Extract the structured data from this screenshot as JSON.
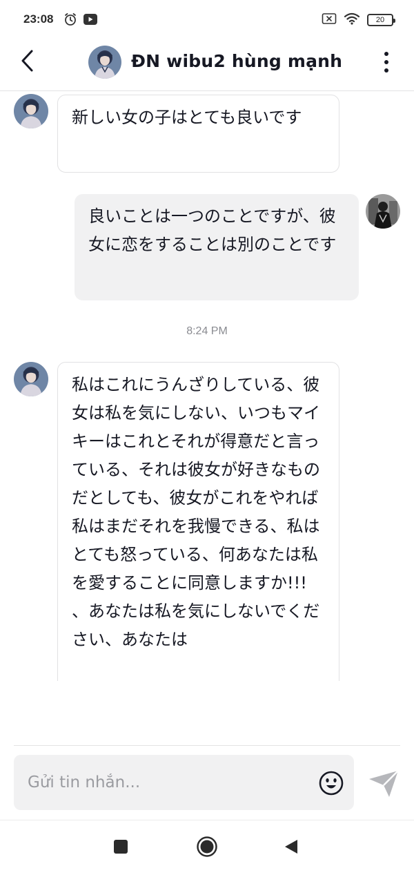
{
  "status_bar": {
    "time": "23:08",
    "battery": "20",
    "icons_left": [
      "alarm-icon",
      "video-app-icon"
    ],
    "icons_right": [
      "sim-blocked-icon",
      "wifi-icon",
      "battery-icon"
    ]
  },
  "header": {
    "title": "ĐN wibu2 hùng mạnh",
    "back_icon": "chevron-left-icon",
    "more_icon": "more-vertical-icon"
  },
  "messages": [
    {
      "direction": "incoming",
      "text": "新しい女の子はとても良いです"
    },
    {
      "direction": "outgoing",
      "text": "良いことは一つのことですが、彼女に恋をすることは別のことです"
    },
    {
      "type": "timestamp",
      "text": "8:24 PM"
    },
    {
      "direction": "incoming",
      "text": "私はこれにうんざりしている、彼女は私を気にしない、いつもマイキーはこれとそれが得意だと言っている、それは彼女が好きなものだとしても、彼女がこれをやれば私はまだそれを我慢できる、私はとても怒っている、何あなたは私を愛することに同意しますか!!! 、あなたは私を気にしないでください、あなたは"
    }
  ],
  "composer": {
    "placeholder": "Gửi tin nhắn...",
    "emoji_icon": "smiley-face-icon",
    "send_icon": "send-icon"
  },
  "nav_bar": {
    "icons": [
      "recent-apps-icon",
      "home-icon",
      "back-triangle-icon"
    ]
  },
  "colors": {
    "text": "#161823",
    "bubble_in_border": "#e1e1e3",
    "bubble_out_bg": "#f1f1f2",
    "timestamp": "#8a8b91",
    "send_icon": "#b6b7bb"
  }
}
